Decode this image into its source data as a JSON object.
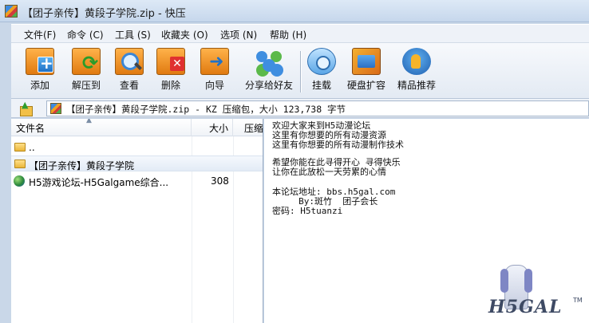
{
  "window": {
    "title": "【团子亲传】黄段子学院.zip - 快压"
  },
  "menu": [
    "文件(F)",
    "命令 (C)",
    "工具 (S)",
    "收藏夹 (O)",
    "选项 (N)",
    "帮助 (H)"
  ],
  "toolbar": {
    "add": "添加",
    "extract": "解压到",
    "view": "查看",
    "delete": "删除",
    "wizard": "向导",
    "share": "分享给好友",
    "mount": "挂载",
    "disk": "硬盘扩容",
    "recommend": "精品推荐"
  },
  "address": "【团子亲传】黄段子学院.zip - KZ 压缩包，大小 123,738 字节",
  "columns": {
    "name": "文件名",
    "size": "大小",
    "compressed": "压缩"
  },
  "files": [
    {
      "name": "..",
      "size": "",
      "icon": "folder-up-icon"
    },
    {
      "name": "【团子亲传】黄段子学院",
      "size": "",
      "icon": "folder-icon"
    },
    {
      "name": "H5游戏论坛-H5Galgame综合...",
      "size": "308",
      "icon": "globe-icon"
    }
  ],
  "comment": [
    "欢迎大家来到H5动漫论坛",
    "这里有你想要的所有动漫资源",
    "这里有你想要的所有动漫制作技术",
    "",
    "希望你能在此寻得开心 寻得快乐",
    "让你在此放松一天劳累的心情",
    "",
    "本论坛地址: bbs.h5gal.com",
    "     By:斑竹  团子会长",
    "密码: H5tuanzi"
  ],
  "watermark": {
    "text": "H5GAL",
    "tm": "TM"
  },
  "colors": {
    "window_frame": "#c9d7e8",
    "toolbar_orange": "#e07a10",
    "selection": "#e3ebf6"
  }
}
